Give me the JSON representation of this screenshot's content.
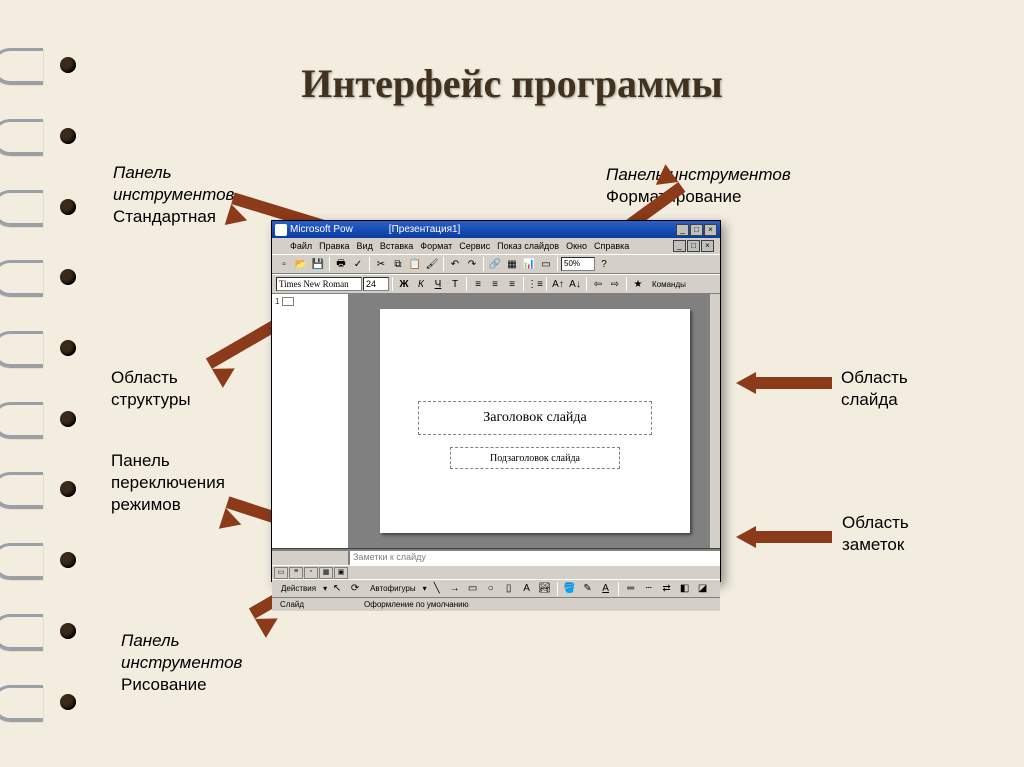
{
  "slide": {
    "title": "Интерфейс программы"
  },
  "callouts": {
    "standard_toolbar_1": "Панель",
    "standard_toolbar_2": "инструментов",
    "standard_toolbar_3": "Стандартная",
    "formatting_toolbar_1": "Панель инструментов",
    "formatting_toolbar_2": "Форматирование",
    "outline_1": "Область",
    "outline_2": "структуры",
    "view_switch_1": "Панель",
    "view_switch_2": "переключения",
    "view_switch_3": "режимов",
    "drawing_toolbar_1": "Панель",
    "drawing_toolbar_2": "инструментов",
    "drawing_toolbar_3": "Рисование",
    "slide_area_1": "Область",
    "slide_area_2": "слайда",
    "notes_area_1": "Область",
    "notes_area_2": "заметок"
  },
  "app": {
    "title_prefix": "Microsoft Pow",
    "title_doc": "[Презентация1]",
    "menu": [
      "Файл",
      "Правка",
      "Вид",
      "Вставка",
      "Формат",
      "Сервис",
      "Показ слайдов",
      "Окно",
      "Справка"
    ],
    "zoom": "50%",
    "font": "Times New Roman",
    "font_size": "24",
    "commands_label": "Команды",
    "outline_num": "1",
    "slide_title_ph": "Заголовок слайда",
    "slide_sub_ph": "Подзаголовок слайда",
    "notes_ph": "Заметки к слайду",
    "draw_actions": "Действия",
    "autoshapes": "Автофигуры",
    "status_slide": "Слайд",
    "status_design": "Оформление по умолчанию"
  }
}
